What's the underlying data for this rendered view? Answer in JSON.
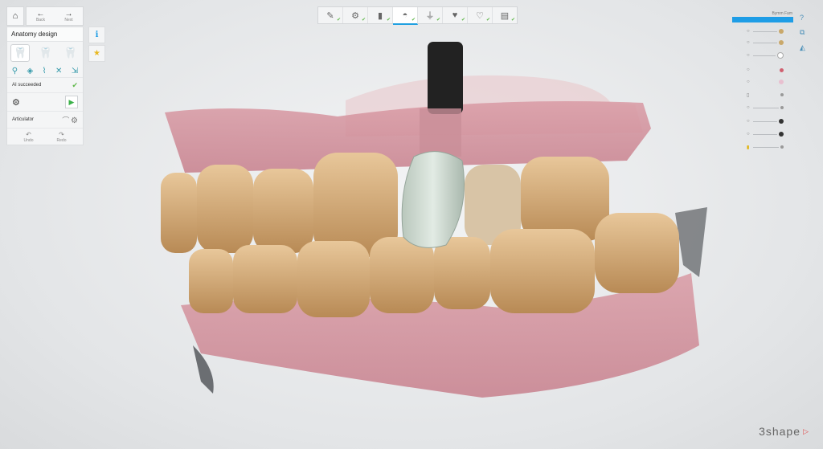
{
  "nav": {
    "back_label": "Back",
    "next_label": "Next"
  },
  "panel": {
    "title": "Anatomy design",
    "ai_status": "AI succeeded",
    "articulator_label": "Articulator",
    "undo_label": "Undo",
    "redo_label": "Redo"
  },
  "right_panel": {
    "title": "Bymm Fam"
  },
  "brand": {
    "name": "3shape"
  },
  "colors": {
    "accent": "#1e9de6",
    "success": "#5fb84a",
    "play": "#3bb14a"
  },
  "icons": {
    "home": "home-icon",
    "info": "info-icon",
    "star": "star-icon",
    "steps": [
      "prep-scan-icon",
      "margin-icon",
      "insertion-icon",
      "anatomy-icon",
      "tooth-design-icon",
      "crown-icon",
      "finalize-icon",
      "export-icon"
    ],
    "right_tools": [
      "help-icon",
      "copy-icon",
      "view-icon"
    ]
  }
}
